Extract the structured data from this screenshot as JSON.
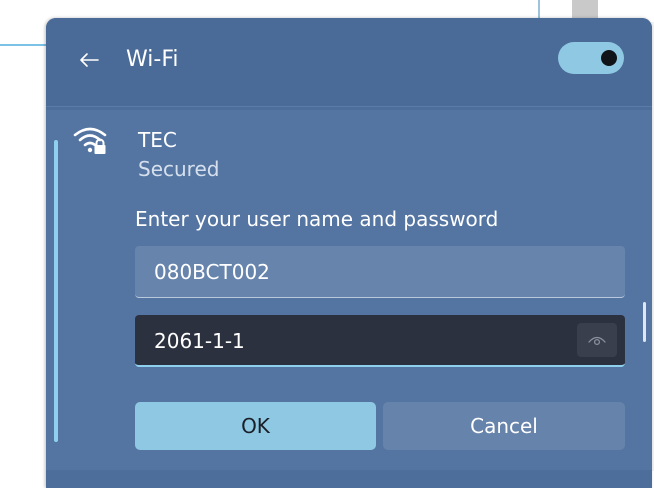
{
  "header": {
    "title": "Wi-Fi",
    "back_icon": "arrow-left-icon",
    "toggle_state": "on",
    "accent_color": "#8fc8e3"
  },
  "network": {
    "name": "TEC",
    "status": "Secured",
    "icon": "wifi-secured-icon"
  },
  "login": {
    "prompt": "Enter your user name and password",
    "username_value": "080BCT002",
    "password_value": "2061-1-1",
    "reveal_icon": "eye-icon"
  },
  "buttons": {
    "ok_label": "OK",
    "cancel_label": "Cancel"
  }
}
